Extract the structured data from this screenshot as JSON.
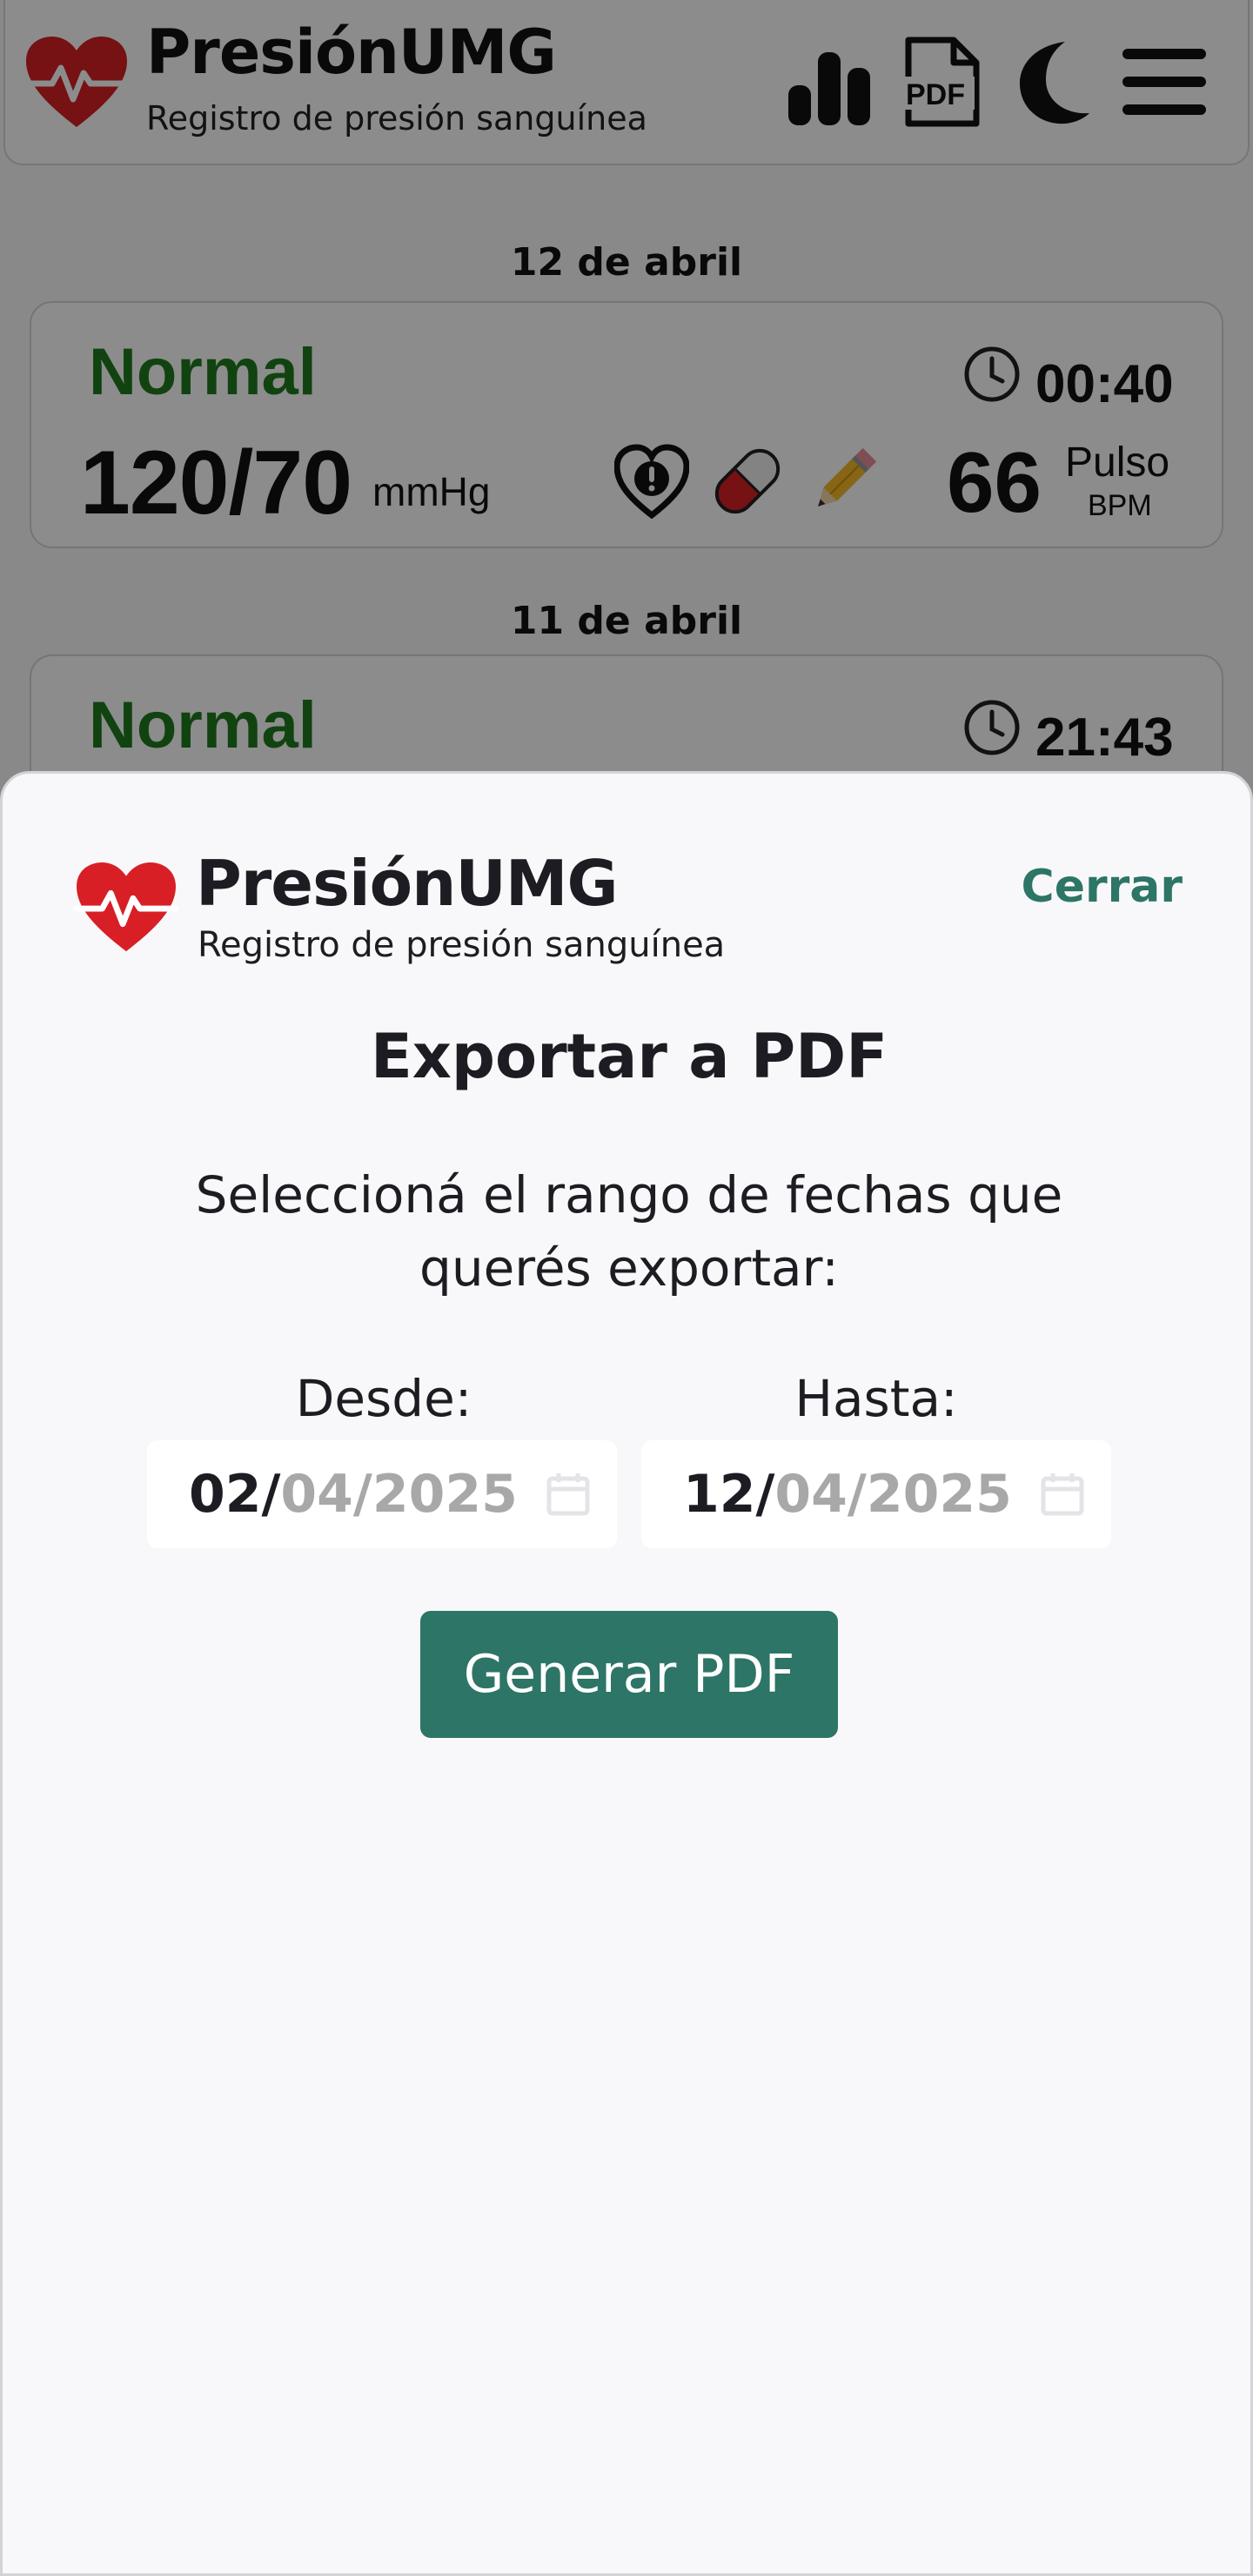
{
  "app": {
    "title": "PresiónUMG",
    "subtitle": "Registro de presión sanguínea"
  },
  "header_icons": [
    "chart-icon",
    "pdf-icon",
    "moon-icon",
    "menu-icon"
  ],
  "records": [
    {
      "date": "12 de abril",
      "status": "Normal",
      "time": "00:40",
      "bp": "120/70",
      "unit": "mmHg",
      "pulse": "66",
      "pulse_label": "Pulso",
      "pulse_unit": "BPM",
      "icons": [
        "heart-alert-icon",
        "pill-icon",
        "pencil-icon"
      ]
    },
    {
      "date": "11 de abril",
      "status": "Normal",
      "time": "21:43"
    }
  ],
  "modal": {
    "close_label": "Cerrar",
    "heading": "Exportar a PDF",
    "instructions": "Seleccioná el rango de fechas que querés exportar:",
    "from_label": "Desde:",
    "to_label": "Hasta:",
    "from": {
      "day": "02",
      "month": "04",
      "year": "2025"
    },
    "to": {
      "day": "12",
      "month": "04",
      "year": "2025"
    },
    "generate_label": "Generar PDF"
  },
  "colors": {
    "accent": "#2d7566",
    "status_normal": "#1f7a1f",
    "heart": "#d81f26"
  }
}
